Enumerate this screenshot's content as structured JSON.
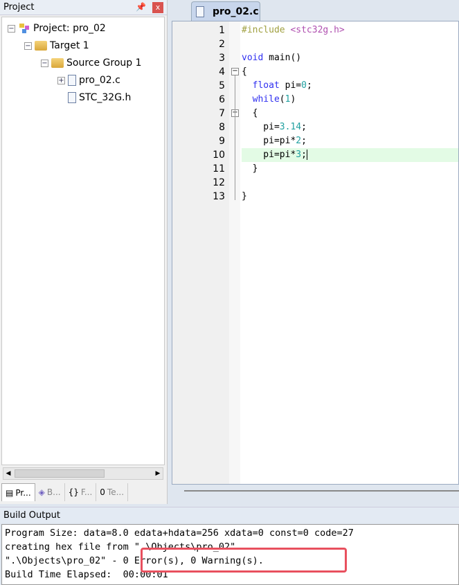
{
  "project_panel": {
    "title": "Project",
    "pin_icon": "pin-icon",
    "close_label": "x",
    "tree": [
      {
        "label": "Project: pro_02",
        "icon": "project-icon",
        "expander": "−"
      },
      {
        "label": "Target 1",
        "icon": "target-folder-icon",
        "expander": "−"
      },
      {
        "label": "Source Group 1",
        "icon": "folder-icon",
        "expander": "−"
      },
      {
        "label": "pro_02.c",
        "icon": "c-file-icon",
        "expander": "+"
      },
      {
        "label": "STC_32G.h",
        "icon": "h-file-icon",
        "expander": ""
      }
    ],
    "tabs": [
      {
        "label": "Pr...",
        "icon": "project-tab-icon"
      },
      {
        "label": "B...",
        "icon": "books-icon"
      },
      {
        "label": "F...",
        "icon": "functions-icon",
        "glyph": "{}"
      },
      {
        "label": "Te...",
        "icon": "templates-icon",
        "glyph": "0"
      }
    ]
  },
  "editor": {
    "tab": "pro_02.c",
    "current_line": 10,
    "lines": [
      {
        "n": "1",
        "tokens": [
          {
            "t": "#include ",
            "k": "pre"
          },
          {
            "t": "<stc32g.h>",
            "k": "inc"
          }
        ]
      },
      {
        "n": "2",
        "tokens": []
      },
      {
        "n": "3",
        "tokens": [
          {
            "t": "void",
            "k": "kw"
          },
          {
            "t": " main()",
            "k": "txt"
          }
        ]
      },
      {
        "n": "4",
        "tokens": [
          {
            "t": "{",
            "k": "txt"
          }
        ]
      },
      {
        "n": "5",
        "tokens": [
          {
            "t": "  ",
            "k": "txt"
          },
          {
            "t": "float",
            "k": "kw"
          },
          {
            "t": " pi=",
            "k": "txt"
          },
          {
            "t": "0",
            "k": "num"
          },
          {
            "t": ";",
            "k": "txt"
          }
        ]
      },
      {
        "n": "6",
        "tokens": [
          {
            "t": "  ",
            "k": "txt"
          },
          {
            "t": "while",
            "k": "kw"
          },
          {
            "t": "(",
            "k": "txt"
          },
          {
            "t": "1",
            "k": "num"
          },
          {
            "t": ")",
            "k": "txt"
          }
        ]
      },
      {
        "n": "7",
        "tokens": [
          {
            "t": "  {",
            "k": "txt"
          }
        ]
      },
      {
        "n": "8",
        "tokens": [
          {
            "t": "    pi=",
            "k": "txt"
          },
          {
            "t": "3.14",
            "k": "num"
          },
          {
            "t": ";",
            "k": "txt"
          }
        ]
      },
      {
        "n": "9",
        "tokens": [
          {
            "t": "    pi=pi*",
            "k": "txt"
          },
          {
            "t": "2",
            "k": "num"
          },
          {
            "t": ";",
            "k": "txt"
          }
        ]
      },
      {
        "n": "10",
        "tokens": [
          {
            "t": "    pi=pi*",
            "k": "txt"
          },
          {
            "t": "3",
            "k": "num"
          },
          {
            "t": ";",
            "k": "txt"
          }
        ]
      },
      {
        "n": "11",
        "tokens": [
          {
            "t": "  }",
            "k": "txt"
          }
        ]
      },
      {
        "n": "12",
        "tokens": []
      },
      {
        "n": "13",
        "tokens": [
          {
            "t": "}",
            "k": "txt"
          }
        ]
      }
    ]
  },
  "build_output": {
    "title": "Build Output",
    "lines": [
      "Program Size: data=8.0 edata+hdata=256 xdata=0 const=0 code=27",
      "creating hex file from \".\\Objects\\pro_02\"...",
      "\".\\Objects\\pro_02\" - 0 Error(s), 0 Warning(s).",
      "Build Time Elapsed:  00:00:01"
    ],
    "highlight_color": "#e8505e"
  }
}
